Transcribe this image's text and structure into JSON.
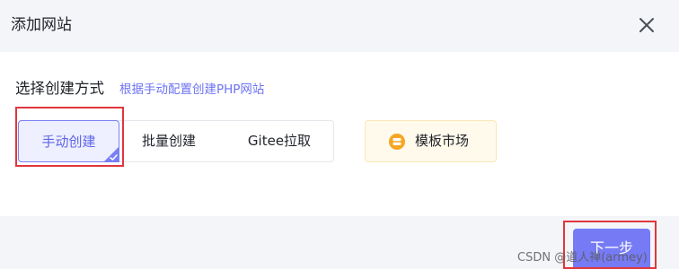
{
  "dialog": {
    "title": "添加网站",
    "close_icon": "close-icon"
  },
  "create": {
    "section_label": "选择创建方式",
    "hint_link": "根据手动配置创建PHP网站",
    "modes": [
      {
        "label": "手动创建",
        "selected": true
      },
      {
        "label": "批量创建",
        "selected": false
      },
      {
        "label": "Gitee拉取",
        "selected": false
      }
    ],
    "template": {
      "label": "模板市场",
      "icon": "template-store-icon"
    }
  },
  "footer": {
    "next_label": "下一步",
    "watermark": "CSDN @道人禅(armey)"
  },
  "colors": {
    "accent": "#767bf5",
    "link": "#6d73f2",
    "annotation": "#e0363d",
    "template_bg": "#fffaeb"
  }
}
